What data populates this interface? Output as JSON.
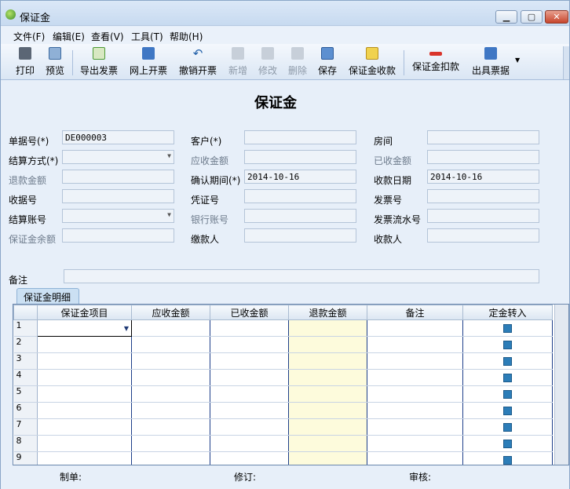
{
  "window": {
    "title": "保证金"
  },
  "menu": [
    "文件(F)",
    "编辑(E)",
    "查看(V)",
    "工具(T)",
    "帮助(H)"
  ],
  "toolbar": [
    {
      "label": "打印",
      "icon": "print-icon",
      "enabled": true
    },
    {
      "label": "预览",
      "icon": "preview-icon",
      "enabled": true
    },
    {
      "label": "导出发票",
      "icon": "export-invoice-icon",
      "enabled": true
    },
    {
      "label": "网上开票",
      "icon": "online-invoice-icon",
      "enabled": true
    },
    {
      "label": "撤销开票",
      "icon": "undo-invoice-icon",
      "enabled": true
    },
    {
      "label": "新增",
      "icon": "add-icon",
      "enabled": false
    },
    {
      "label": "修改",
      "icon": "edit-icon",
      "enabled": false
    },
    {
      "label": "删除",
      "icon": "delete-icon",
      "enabled": false
    },
    {
      "label": "保存",
      "icon": "save-icon",
      "enabled": true
    },
    {
      "label": "保证金收款",
      "icon": "deposit-receipt-icon",
      "enabled": true
    },
    {
      "label": "保证金扣款",
      "icon": "deposit-deduct-icon",
      "enabled": true
    },
    {
      "label": "出具票据",
      "icon": "issue-bill-icon",
      "enabled": true
    }
  ],
  "form": {
    "title": "保证金",
    "fields": {
      "doc_no": {
        "label": "单据号(*)",
        "value": "DE000003"
      },
      "customer": {
        "label": "客户(*)",
        "value": ""
      },
      "room": {
        "label": "房间",
        "value": ""
      },
      "settle_method": {
        "label": "结算方式(*)",
        "value": ""
      },
      "receivable": {
        "label": "应收金额",
        "value": ""
      },
      "received": {
        "label": "已收金额",
        "value": ""
      },
      "refund": {
        "label": "退款金额",
        "value": ""
      },
      "confirm_period": {
        "label": "确认期间(*)",
        "value": "2014-10-16"
      },
      "receipt_date": {
        "label": "收款日期",
        "value": "2014-10-16"
      },
      "receipt_no": {
        "label": "收据号",
        "value": ""
      },
      "voucher_no": {
        "label": "凭证号",
        "value": ""
      },
      "invoice_no": {
        "label": "发票号",
        "value": ""
      },
      "settle_account": {
        "label": "结算账号",
        "value": ""
      },
      "bank_account": {
        "label": "银行账号",
        "value": ""
      },
      "invoice_serial": {
        "label": "发票流水号",
        "value": ""
      },
      "deposit_balance": {
        "label": "保证金余额",
        "value": ""
      },
      "payer": {
        "label": "缴款人",
        "value": ""
      },
      "payee": {
        "label": "收款人",
        "value": ""
      },
      "remark": {
        "label": "备注",
        "value": ""
      }
    }
  },
  "detail": {
    "tab_label": "保证金明细",
    "columns": [
      "保证金项目",
      "应收金额",
      "已收金额",
      "退款金额",
      "备注",
      "定金转入"
    ],
    "row_numbers": [
      "1",
      "2",
      "3",
      "4",
      "5",
      "6",
      "7",
      "8",
      "9"
    ]
  },
  "footer": {
    "maker": "制单:",
    "reviser": "修订:",
    "auditor": "审核:"
  }
}
